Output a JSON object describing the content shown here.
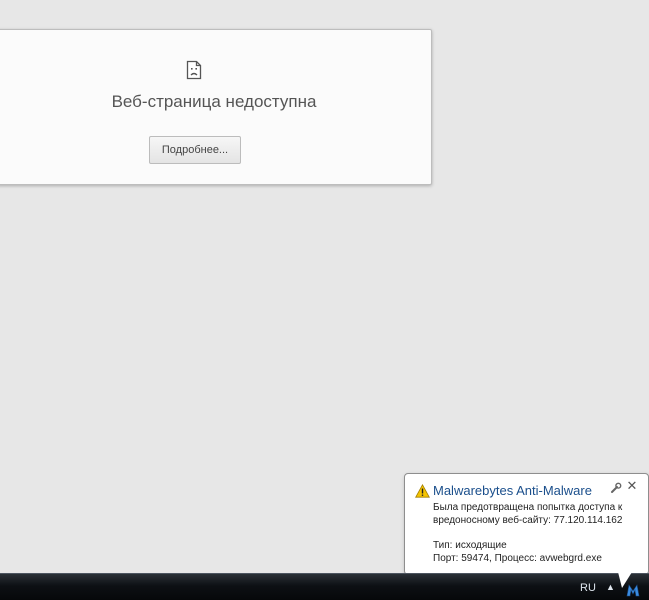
{
  "error_page": {
    "title": "Веб-страница недоступна",
    "details_button": "Подробнее..."
  },
  "notification": {
    "app_title": "Malwarebytes Anti-Malware",
    "message_line1": "Была предотвращена попытка доступа к",
    "message_line2": "вредоносному веб-сайту:  77.120.114.162",
    "type_line": "Тип:  исходящие",
    "port_process_line": "Порт:  59474, Процесс:  avwebgrd.exe"
  },
  "taskbar": {
    "language": "RU",
    "tray_expand": "▲"
  },
  "icons": {
    "sad_document": "sad-document-icon",
    "warning": "warning-icon",
    "wrench": "wrench-icon",
    "close": "close-icon",
    "malwarebytes_tray": "malwarebytes-tray-icon"
  },
  "colors": {
    "background": "#e7e7e7",
    "notification_title": "#1b4f8c",
    "taskbar": "#0d1014"
  }
}
